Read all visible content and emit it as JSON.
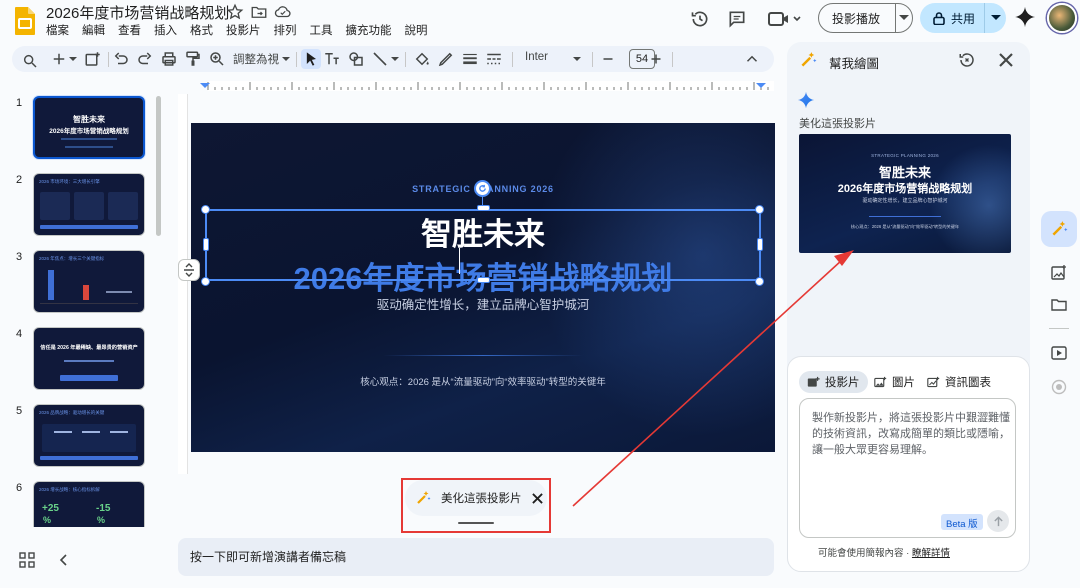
{
  "header": {
    "title": "2026年度市场营销战略规划",
    "menu": [
      "檔案",
      "編輯",
      "查看",
      "插入",
      "格式",
      "投影片",
      "排列",
      "工具",
      "擴充功能",
      "說明"
    ],
    "present_label": "投影播放",
    "share_label": "共用"
  },
  "toolbar": {
    "zoom_label": "調整為視",
    "font_name": "Inter",
    "font_size": "54"
  },
  "filmstrip": {
    "numbers": [
      "1",
      "2",
      "3",
      "4",
      "5",
      "6"
    ],
    "t1_title": "智胜未来",
    "t1_sub": "2026年度市场营销战略规划",
    "t2_head": "2026 市场环境：三大增长引擎",
    "t3_head": "2026 年焦点：增长三个关键指标",
    "t4_head": "信任是 2026 年最稀缺、最昂贵的营销资产",
    "t5_head": "2026 品牌战略：驱动增长的关键",
    "t6_head": "2026 增长战略：核心指标拆解",
    "t6_stats": [
      "+25",
      "-15",
      "%",
      "%"
    ]
  },
  "slide": {
    "kicker": "STRATEGIC PLANNING 2026",
    "title": "智胜未来",
    "title2": "2026年度市场营销战略规划",
    "subtitle": "驱动确定性增长，建立品牌心智护城河",
    "core": "核心观点：2026 是从“流量驱动”向“效率驱动”转型的关键年"
  },
  "beautify": {
    "label": "美化這張投影片"
  },
  "notes": {
    "placeholder": "按一下即可新增演講者備忘稿"
  },
  "panel": {
    "title": "幫我繪圖",
    "section_label": "美化這張投影片",
    "preview_kicker": "STRATEGIC PLANNING 2026",
    "preview_title": "智胜未来",
    "preview_title2": "2026年度市场营销战略规划",
    "preview_sub": "驱动确定性增长，建立品牌心智护城河",
    "preview_core": "核心观点：2026 是从“流量驱动”向“效率驱动”转型的关键年",
    "tabs": [
      "投影片",
      "圖片",
      "資訊圖表"
    ],
    "prompt_text": "製作新投影片，將這張投影片中艱澀難懂的技術資訊，改寫成簡單的類比或隱喻，讓一般大眾更容易理解。",
    "beta": "Beta 版",
    "footer_text": "可能會使用簡報內容 · ",
    "footer_link": "瞭解詳情"
  },
  "colors": {
    "accent": "#0b57d0",
    "slide_bg": "#0e1733",
    "title_blue": "#3f7be6",
    "highlight_red": "#e53935"
  }
}
